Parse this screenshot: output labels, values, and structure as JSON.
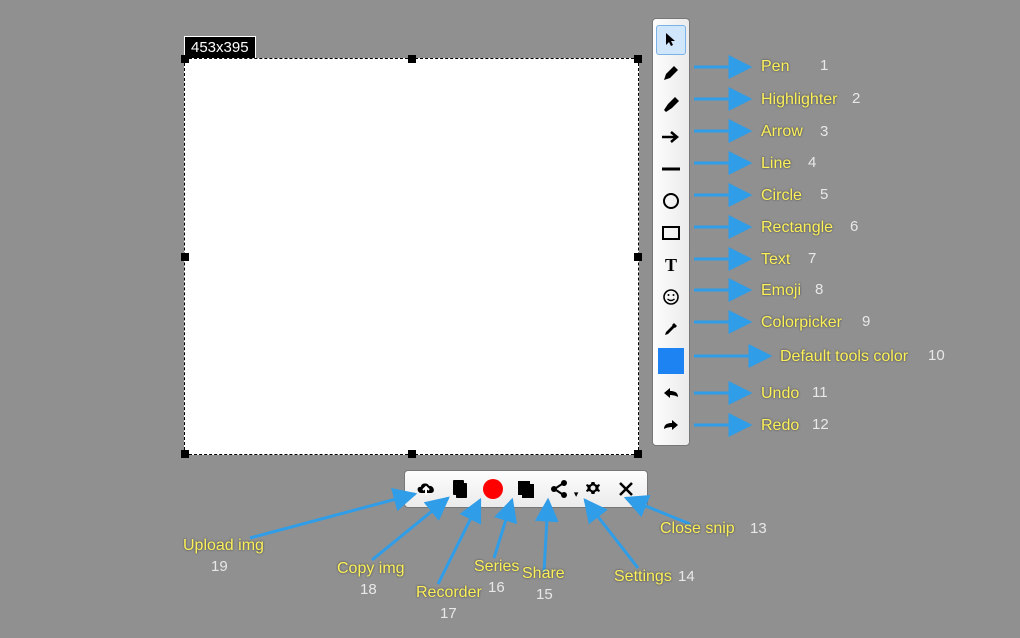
{
  "dimension_label": "453x395",
  "accent_color": "#1d82f2",
  "tools": [
    {
      "id": "cursor",
      "name": "cursor-icon",
      "label": "",
      "num": ""
    },
    {
      "id": "pen",
      "name": "pen-icon",
      "label": "Pen",
      "num": "1"
    },
    {
      "id": "highlighter",
      "name": "highlighter-icon",
      "label": "Highlighter",
      "num": "2"
    },
    {
      "id": "arrow",
      "name": "arrow-icon",
      "label": "Arrow",
      "num": "3"
    },
    {
      "id": "line",
      "name": "line-icon",
      "label": "Line",
      "num": "4"
    },
    {
      "id": "circle",
      "name": "circle-icon",
      "label": "Circle",
      "num": "5"
    },
    {
      "id": "rectangle",
      "name": "rectangle-icon",
      "label": "Rectangle",
      "num": "6"
    },
    {
      "id": "text",
      "name": "text-icon",
      "label": "Text",
      "num": "7"
    },
    {
      "id": "emoji",
      "name": "emoji-icon",
      "label": "Emoji",
      "num": "8"
    },
    {
      "id": "colorpicker",
      "name": "colorpicker-icon",
      "label": "Colorpicker",
      "num": "9"
    },
    {
      "id": "default-color",
      "name": "color-swatch",
      "label": "Default tools color",
      "num": "10"
    },
    {
      "id": "undo",
      "name": "undo-icon",
      "label": "Undo",
      "num": "11"
    },
    {
      "id": "redo",
      "name": "redo-icon",
      "label": "Redo",
      "num": "12"
    }
  ],
  "actions": [
    {
      "id": "upload",
      "name": "upload-icon",
      "label": "Upload img",
      "num": "19"
    },
    {
      "id": "copy",
      "name": "copy-icon",
      "label": "Copy img",
      "num": "18"
    },
    {
      "id": "record",
      "name": "record-icon",
      "label": "Recorder",
      "num": "17"
    },
    {
      "id": "series",
      "name": "series-icon",
      "label": "Series",
      "num": "16"
    },
    {
      "id": "share",
      "name": "share-icon",
      "label": "Share",
      "num": "15"
    },
    {
      "id": "settings",
      "name": "settings-icon",
      "label": "Settings",
      "num": "14"
    },
    {
      "id": "close",
      "name": "close-icon",
      "label": "Close snip",
      "num": "13"
    }
  ]
}
